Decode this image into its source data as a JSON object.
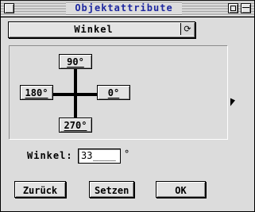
{
  "window": {
    "title": "Objektattribute"
  },
  "mode_popup": {
    "selected": "Winkel",
    "button_glyph": "⟳"
  },
  "direction_buttons": {
    "up": "90°",
    "left": "180°",
    "right": "0°",
    "down": "270°"
  },
  "angle_field": {
    "label": "Winkel:",
    "value": "33",
    "mask": "____",
    "unit": "°"
  },
  "actions": {
    "back": "Zurück",
    "set": "Setzen",
    "ok": "OK"
  },
  "colors": {
    "title_text": "#1e28a0",
    "window_bg": "#dcdcdc"
  },
  "icons": {
    "cursor": "arrow-cursor-icon"
  }
}
